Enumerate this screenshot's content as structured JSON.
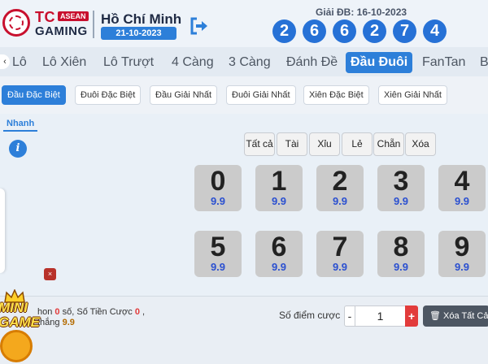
{
  "brand": {
    "tc": "TC",
    "asean": "ASEAN",
    "gaming": "GAMING"
  },
  "header": {
    "city": "Hồ Chí Minh",
    "date": "21-10-2023",
    "special_prize_label": "Giải ĐB: 16-10-2023",
    "special_prize_digits": [
      "2",
      "6",
      "6",
      "2",
      "7",
      "4"
    ]
  },
  "tabs": [
    {
      "label": "Lô"
    },
    {
      "label": "Lô Xiên"
    },
    {
      "label": "Lô Trượt"
    },
    {
      "label": "4 Càng"
    },
    {
      "label": "3 Càng"
    },
    {
      "label": "Đánh Đề"
    },
    {
      "label": "Đầu Đuôi"
    },
    {
      "label": "FanTan"
    },
    {
      "label": "B"
    }
  ],
  "active_tab": "Đầu Đuôi",
  "subtabs": [
    {
      "label": "Đầu Đặc Biệt"
    },
    {
      "label": "Đuôi Đặc Biệt"
    },
    {
      "label": "Đầu Giải Nhất"
    },
    {
      "label": "Đuôi Giải Nhất"
    },
    {
      "label": "Xiên Đặc Biệt"
    },
    {
      "label": "Xiên Giải Nhất"
    }
  ],
  "mode": "Nhanh",
  "filters": [
    {
      "label": "Tất cả"
    },
    {
      "label": "Tài"
    },
    {
      "label": "Xỉu"
    },
    {
      "label": "Lẻ"
    },
    {
      "label": "Chẵn"
    },
    {
      "label": "Xóa"
    }
  ],
  "digits": [
    {
      "digit": "0",
      "odds": "9.9"
    },
    {
      "digit": "1",
      "odds": "9.9"
    },
    {
      "digit": "2",
      "odds": "9.9"
    },
    {
      "digit": "3",
      "odds": "9.9"
    },
    {
      "digit": "4",
      "odds": "9.9"
    },
    {
      "digit": "5",
      "odds": "9.9"
    },
    {
      "digit": "6",
      "odds": "9.9"
    },
    {
      "digit": "7",
      "odds": "9.9"
    },
    {
      "digit": "8",
      "odds": "9.9"
    },
    {
      "digit": "9",
      "odds": "9.9"
    }
  ],
  "summary": {
    "line1_prefix": "hon",
    "selected_count": "0",
    "line1_unit": "số,",
    "bet_label": "Số Tiền Cược",
    "bet_amount": "0",
    "line1_suffix": ",",
    "win_label": "thắng",
    "win_amount": "9.9"
  },
  "points_label": "Số điểm cược",
  "quantity": "1",
  "minus_label": "-",
  "plus_label": "+",
  "clear_all_label": "Xóa Tất Cả",
  "close_label": "×",
  "info_label": "i",
  "tab_arrow_label": "‹",
  "mini_game": {
    "line1": "MINI",
    "line2": "GAME"
  },
  "colors": {
    "primary": "#2d7fd9",
    "ball": "#2671d6",
    "odds": "#2b50d0",
    "plus": "#e23b3b",
    "brand_red": "#c8102e"
  }
}
